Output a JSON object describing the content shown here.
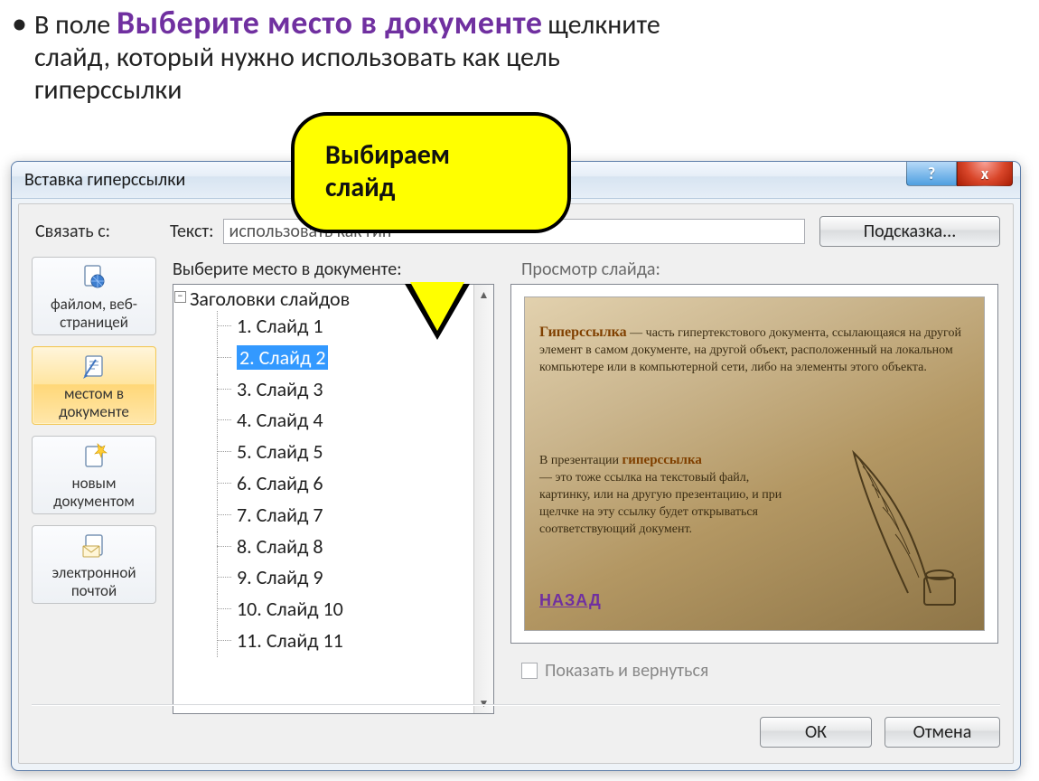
{
  "instruction": {
    "prefix": "В поле ",
    "highlight": "Выберите место в документе",
    "tail1": " щелкните",
    "line2": "слайд, который нужно использовать как цель",
    "line3": "гиперссылки"
  },
  "callout": {
    "line1": "Выбираем",
    "line2": "слайд"
  },
  "dialog": {
    "title": "Вставка гиперссылки",
    "help_symbol": "?",
    "close_symbol": "x",
    "linkto_label": "Связать с:",
    "text_label": "Текст:",
    "text_value": "использовать как гип",
    "hint_button": "Подсказка...",
    "sidebar": [
      {
        "label_l1": "файлом, веб-",
        "label_l2": "страницей",
        "key": "file-web"
      },
      {
        "label_l1": "местом в",
        "label_l2": "документе",
        "key": "place-in-doc",
        "selected": true
      },
      {
        "label_l1": "новым",
        "label_l2": "документом",
        "key": "new-doc"
      },
      {
        "label_l1": "электронной",
        "label_l2": "почтой",
        "key": "email"
      }
    ],
    "tree_label": "Выберите место в документе:",
    "tree_root": "Заголовки слайдов",
    "slides": [
      "1. Слайд 1",
      "2. Слайд 2",
      "3. Слайд 3",
      "4. Слайд 4",
      "5. Слайд 5",
      "6. Слайд 6",
      "7. Слайд 7",
      "8. Слайд 8",
      "9. Слайд 9",
      "10. Слайд 10",
      "11. Слайд 11"
    ],
    "selected_slide_index": 1,
    "preview_label": "Просмотр слайда:",
    "preview": {
      "term1": "Гиперссылка",
      "para1": " — часть гипертекстового документа, ссылающаяся на другой элемент в самом документе, на другой объект, расположенный на локальном компьютере или в компьютерной сети, либо на элементы этого объекта.",
      "para2_pre": "В презентации  ",
      "term2": "гиперссылка",
      "para2": " — это тоже ссылка на текстовый файл, картинку, или на другую презентацию, и при щелчке на эту ссылку будет открываться соответствующий документ.",
      "back": "НАЗАД"
    },
    "show_return": "Показать и вернуться",
    "ok": "ОК",
    "cancel": "Отмена"
  }
}
